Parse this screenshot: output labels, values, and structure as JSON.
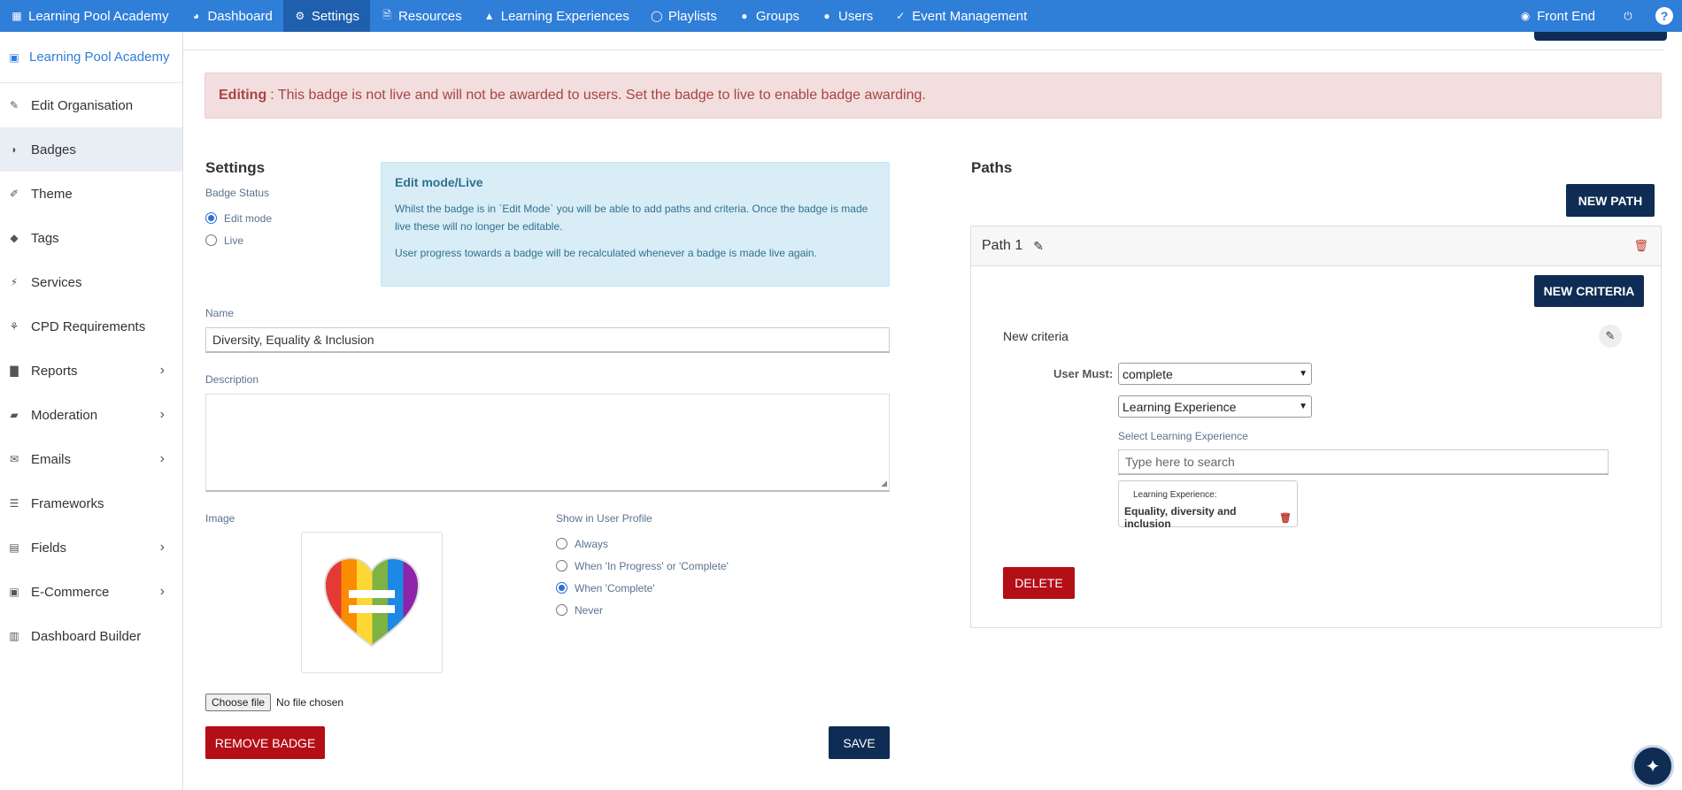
{
  "nav": {
    "brand": "Learning Pool Academy",
    "items": [
      {
        "label": "Dashboard",
        "icon": "dashboard-icon"
      },
      {
        "label": "Settings",
        "icon": "gear-icon"
      },
      {
        "label": "Resources",
        "icon": "file-icon"
      },
      {
        "label": "Learning Experiences",
        "icon": "graduation-cap-icon"
      },
      {
        "label": "Playlists",
        "icon": "lightbulb-icon"
      },
      {
        "label": "Groups",
        "icon": "users-icon"
      },
      {
        "label": "Users",
        "icon": "user-icon"
      },
      {
        "label": "Event Management",
        "icon": "event-icon"
      }
    ],
    "front_end": "Front End"
  },
  "sidebar": {
    "header": "Learning Pool Academy",
    "items": [
      {
        "label": "Edit Organisation",
        "icon": "pencil-icon",
        "chevron": false
      },
      {
        "label": "Badges",
        "icon": "shield-icon",
        "chevron": false
      },
      {
        "label": "Theme",
        "icon": "brush-icon",
        "chevron": false
      },
      {
        "label": "Tags",
        "icon": "tags-icon",
        "chevron": false
      },
      {
        "label": "Services",
        "icon": "plug-icon",
        "chevron": false
      },
      {
        "label": "CPD Requirements",
        "icon": "seedling-icon",
        "chevron": false
      },
      {
        "label": "Reports",
        "icon": "bar-chart-icon",
        "chevron": true
      },
      {
        "label": "Moderation",
        "icon": "eraser-icon",
        "chevron": true
      },
      {
        "label": "Emails",
        "icon": "envelope-icon",
        "chevron": true
      },
      {
        "label": "Frameworks",
        "icon": "list-icon",
        "chevron": false
      },
      {
        "label": "Fields",
        "icon": "form-icon",
        "chevron": true
      },
      {
        "label": "E-Commerce",
        "icon": "cart-icon",
        "chevron": true
      },
      {
        "label": "Dashboard Builder",
        "icon": "layout-icon",
        "chevron": false
      }
    ]
  },
  "alert": {
    "strong": "Editing",
    "text": ": This badge is not live and will not be awarded to users. Set the badge to live to enable badge awarding."
  },
  "settings": {
    "title": "Settings",
    "status_label": "Badge Status",
    "status_options": [
      "Edit mode",
      "Live"
    ],
    "status_selected": "Edit mode",
    "info_title": "Edit mode/Live",
    "info_p1": "Whilst the badge is in `Edit Mode` you will be able to add paths and criteria. Once the badge is made live these will no longer be editable.",
    "info_p2": "User progress towards a badge will be recalculated whenever a badge is made live again.",
    "name_label": "Name",
    "name_value": "Diversity, Equality & Inclusion",
    "description_label": "Description",
    "description_value": "",
    "image_label": "Image",
    "show_label": "Show in User Profile",
    "show_options": [
      "Always",
      "When 'In Progress' or 'Complete'",
      "When 'Complete'",
      "Never"
    ],
    "show_selected": "When 'Complete'",
    "choose_file": "Choose file",
    "no_file": "No file chosen",
    "remove_badge": "REMOVE BADGE",
    "save": "SAVE"
  },
  "paths": {
    "title": "Paths",
    "new_path": "NEW PATH",
    "path_name": "Path 1",
    "new_criteria": "NEW CRITERIA",
    "criteria_title": "New criteria",
    "user_must_label": "User Must:",
    "action_value": "complete",
    "type_value": "Learning Experience",
    "select_label": "Select Learning Experience",
    "search_placeholder": "Type here to search",
    "tag_label": "Learning Experience:",
    "tag_value": "Equality, diversity and inclusion",
    "delete": "DELETE"
  }
}
